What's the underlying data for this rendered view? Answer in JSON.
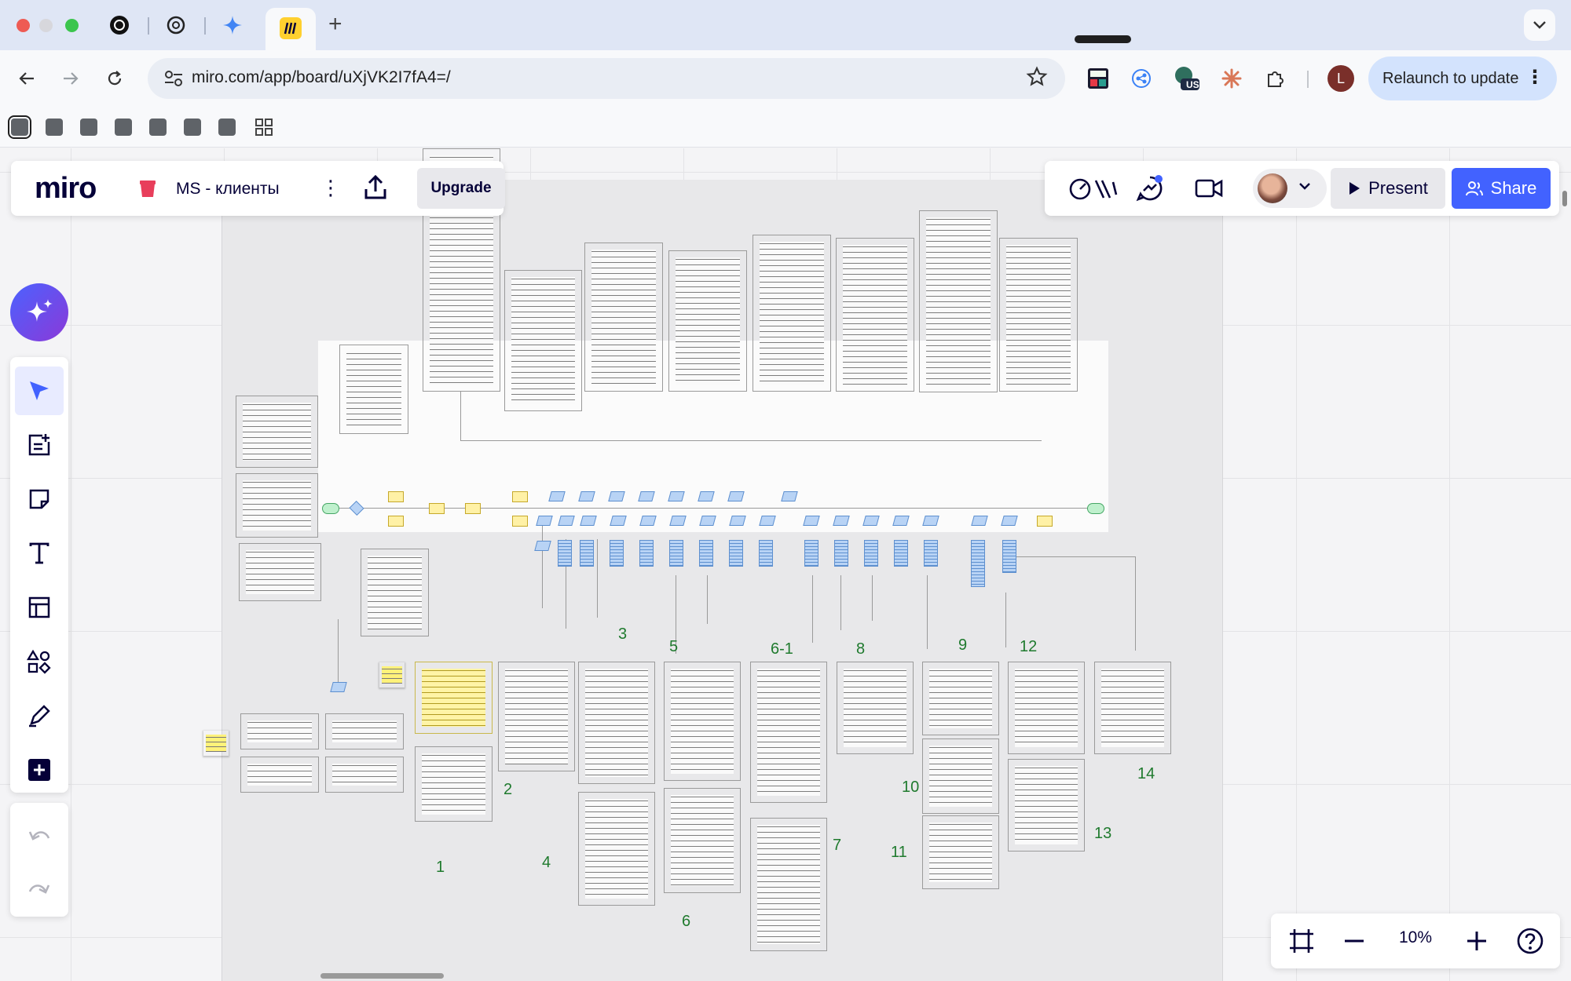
{
  "browser": {
    "url": "miro.com/app/board/uXjVK2I7fA4=/",
    "relaunch_label": "Relaunch to update",
    "profile_initial": "L",
    "ext_badge": "US",
    "new_tab_glyph": "+",
    "tabs": [
      {
        "icon": "openai-icon"
      },
      {
        "icon": "openai-icon"
      },
      {
        "icon": "gemini-icon"
      },
      {
        "icon": "miro-icon",
        "active": true
      }
    ]
  },
  "miro": {
    "logo": "miro",
    "board_name": "MS - клиенты",
    "upgrade_label": "Upgrade",
    "present_label": "Present",
    "share_label": "Share",
    "zoom_level": "10%",
    "accent": "#4262ff"
  },
  "board": {
    "step_numbers": [
      "1",
      "2",
      "3",
      "4",
      "5",
      "6",
      "6-1",
      "7",
      "8",
      "9",
      "10",
      "11",
      "12",
      "13",
      "14"
    ]
  }
}
